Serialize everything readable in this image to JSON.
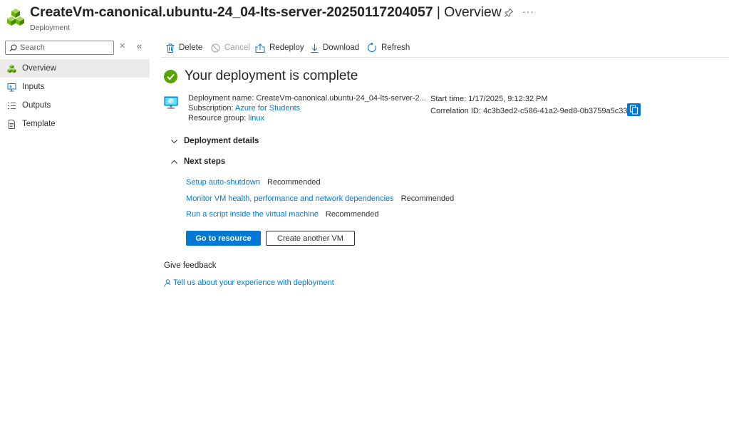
{
  "header": {
    "title": "CreateVm-canonical.ubuntu-24_04-lts-server-20250117204057",
    "title_separator": " | ",
    "title_section": "Overview",
    "subtitle": "Deployment",
    "resource_icon": "deployment-cubes-icon",
    "more_label": "···"
  },
  "sidebar": {
    "search_placeholder": "Search",
    "items": [
      {
        "label": "Overview",
        "icon": "overview-cubes-icon",
        "active": true
      },
      {
        "label": "Inputs",
        "icon": "inputs-icon",
        "active": false
      },
      {
        "label": "Outputs",
        "icon": "outputs-list-icon",
        "active": false
      },
      {
        "label": "Template",
        "icon": "template-doc-icon",
        "active": false
      }
    ]
  },
  "toolbar": {
    "delete": "Delete",
    "cancel": "Cancel",
    "redeploy": "Redeploy",
    "download": "Download",
    "refresh": "Refresh"
  },
  "status": {
    "heading": "Your deployment is complete"
  },
  "details": {
    "deployment_name_label": "Deployment name:",
    "deployment_name_value": "CreateVm-canonical.ubuntu-24_04-lts-server-2...",
    "subscription_label": "Subscription:",
    "subscription_value": "Azure for Students",
    "resource_group_label": "Resource group:",
    "resource_group_value": "linux",
    "start_time_label": "Start time:",
    "start_time_value": "1/17/2025, 9:12:32 PM",
    "correlation_label": "Correlation ID:",
    "correlation_value": "4c3b3ed2-c586-41a2-9ed8-0b3759a5c337"
  },
  "sections": {
    "deployment_details": "Deployment details",
    "next_steps": "Next steps"
  },
  "next_steps": [
    {
      "link": "Setup auto-shutdown",
      "tag": "Recommended"
    },
    {
      "link": "Monitor VM health, performance and network dependencies",
      "tag": "Recommended"
    },
    {
      "link": "Run a script inside the virtual machine",
      "tag": "Recommended"
    }
  ],
  "actions": {
    "primary": "Go to resource",
    "secondary": "Create another VM"
  },
  "feedback": {
    "title": "Give feedback",
    "link": "Tell us about your experience with deployment"
  },
  "colors": {
    "accent": "#0078d4",
    "success": "#57a300",
    "deployment_green": "#6bb700"
  }
}
